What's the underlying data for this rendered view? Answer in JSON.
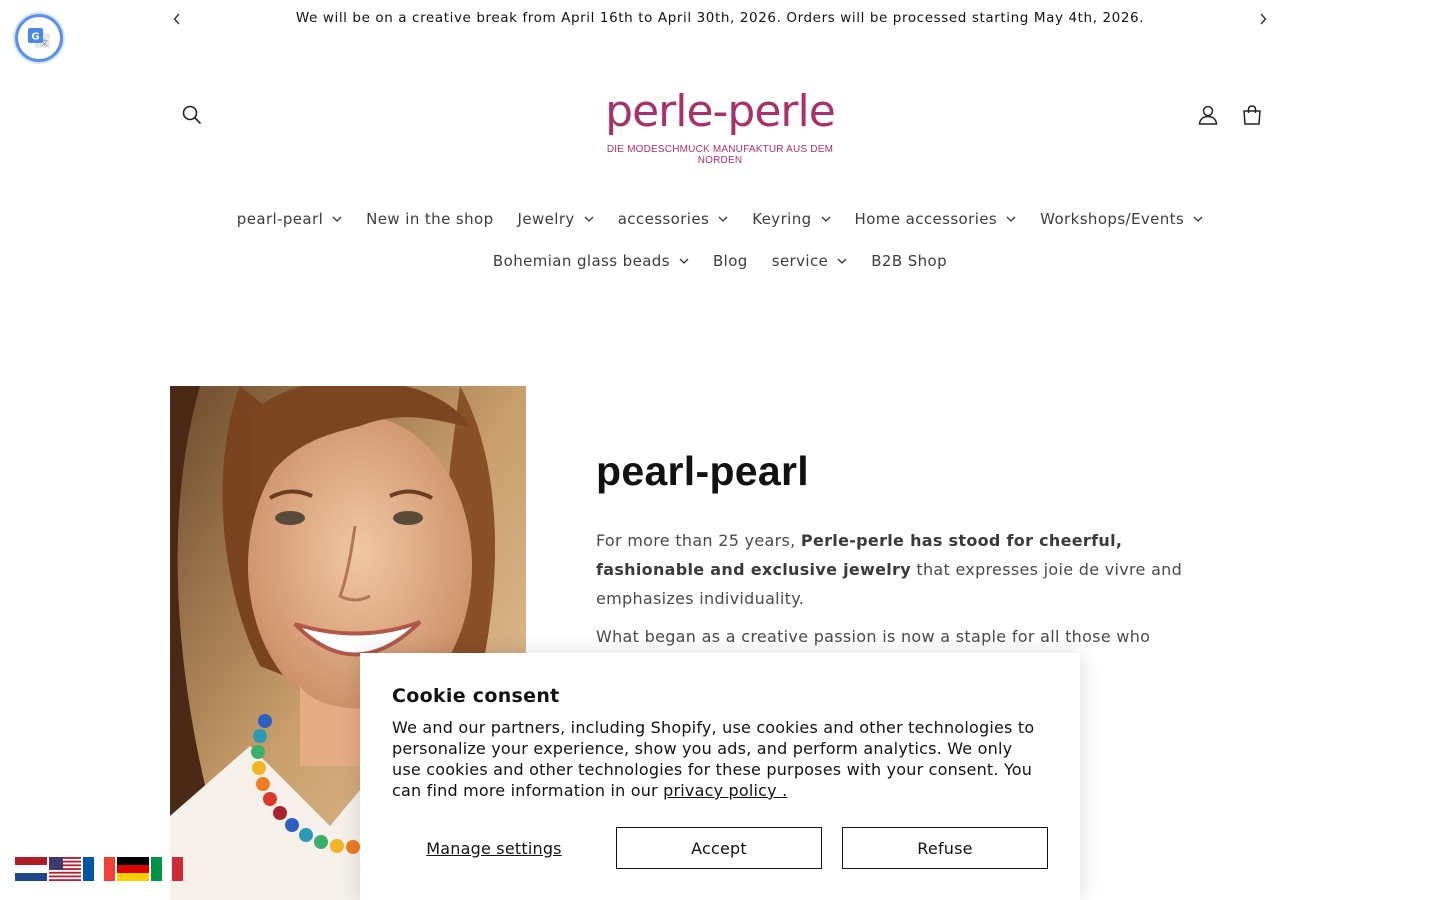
{
  "announcement": {
    "text": "We will be on a creative break from April 16th to April 30th, 2026. Orders will be processed starting May 4th, 2026.",
    "prev_icon": "chevron-left-icon",
    "next_icon": "chevron-right-icon"
  },
  "translate_widget": {
    "icon": "google-translate-icon"
  },
  "header": {
    "logo": {
      "brand": "perle-perle",
      "tagline": "DIE MODESCHMUCK MANUFAKTUR AUS DEM NORDEN"
    },
    "search_icon": "search-icon",
    "account_icon": "account-icon",
    "cart_icon": "cart-icon"
  },
  "nav": {
    "row1": [
      {
        "label": "pearl-pearl",
        "dropdown": true
      },
      {
        "label": "New in the shop",
        "dropdown": false
      },
      {
        "label": "Jewelry",
        "dropdown": true
      },
      {
        "label": "accessories",
        "dropdown": true
      },
      {
        "label": "Keyring",
        "dropdown": true
      },
      {
        "label": "Home accessories",
        "dropdown": true
      },
      {
        "label": "Workshops/Events",
        "dropdown": true
      }
    ],
    "row2": [
      {
        "label": "Bohemian glass beads",
        "dropdown": true
      },
      {
        "label": "Blog",
        "dropdown": false
      },
      {
        "label": "service",
        "dropdown": true
      },
      {
        "label": "B2B Shop",
        "dropdown": false
      }
    ]
  },
  "main": {
    "title": "pearl-pearl",
    "p1": {
      "a": "For more than 25 years, ",
      "b": "Perle-perle has stood for cheerful, fashionable and exclusive jewelry",
      "c": " that expresses joie de vivre and emphasizes individuality."
    },
    "p2": {
      "a": "What began as a creative passion is now a staple for all those who love"
    }
  },
  "cookie": {
    "title": "Cookie consent",
    "body": "We and our partners, including Shopify, use cookies and other technologies to personalize your experience, show you ads, and perform analytics. We only use cookies and other technologies for these purposes with your consent. You can find more information in our ",
    "privacy_link": "privacy policy .",
    "manage_label": "Manage settings",
    "accept_label": "Accept",
    "refuse_label": "Refuse"
  },
  "languages": [
    {
      "code": "nl",
      "icon": "flag-netherlands-icon"
    },
    {
      "code": "en",
      "icon": "flag-usa-icon"
    },
    {
      "code": "fr",
      "icon": "flag-france-icon"
    },
    {
      "code": "de",
      "icon": "flag-germany-icon"
    },
    {
      "code": "it",
      "icon": "flag-italy-icon"
    }
  ],
  "colors": {
    "brand": "#a8316b",
    "text": "#121212",
    "body_text": "#4a4a4a"
  }
}
